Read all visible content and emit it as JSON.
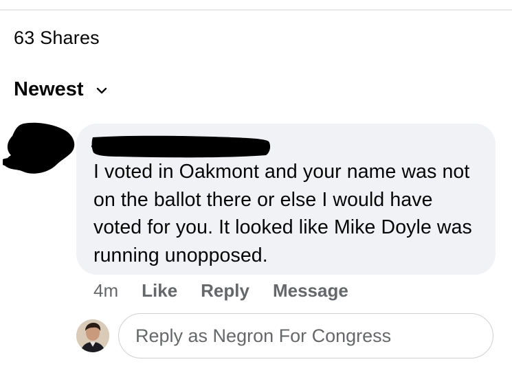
{
  "shares": {
    "count_label": "63 Shares"
  },
  "sort": {
    "label": "Newest",
    "icon": "chevron-down-icon"
  },
  "comment": {
    "text": "I voted in Oakmont and your name was not on the ballot there or else I would have voted for you. It looked like Mike Doyle was running unopposed.",
    "timestamp": "4m",
    "actions": {
      "like": "Like",
      "reply": "Reply",
      "message": "Message"
    }
  },
  "reply_box": {
    "placeholder": "Reply as Negron For Congress",
    "value": ""
  },
  "colors": {
    "bubble_bg": "#f0f2f5",
    "secondary_text": "#65676b",
    "primary_text": "#050505",
    "redaction": "#000000"
  }
}
